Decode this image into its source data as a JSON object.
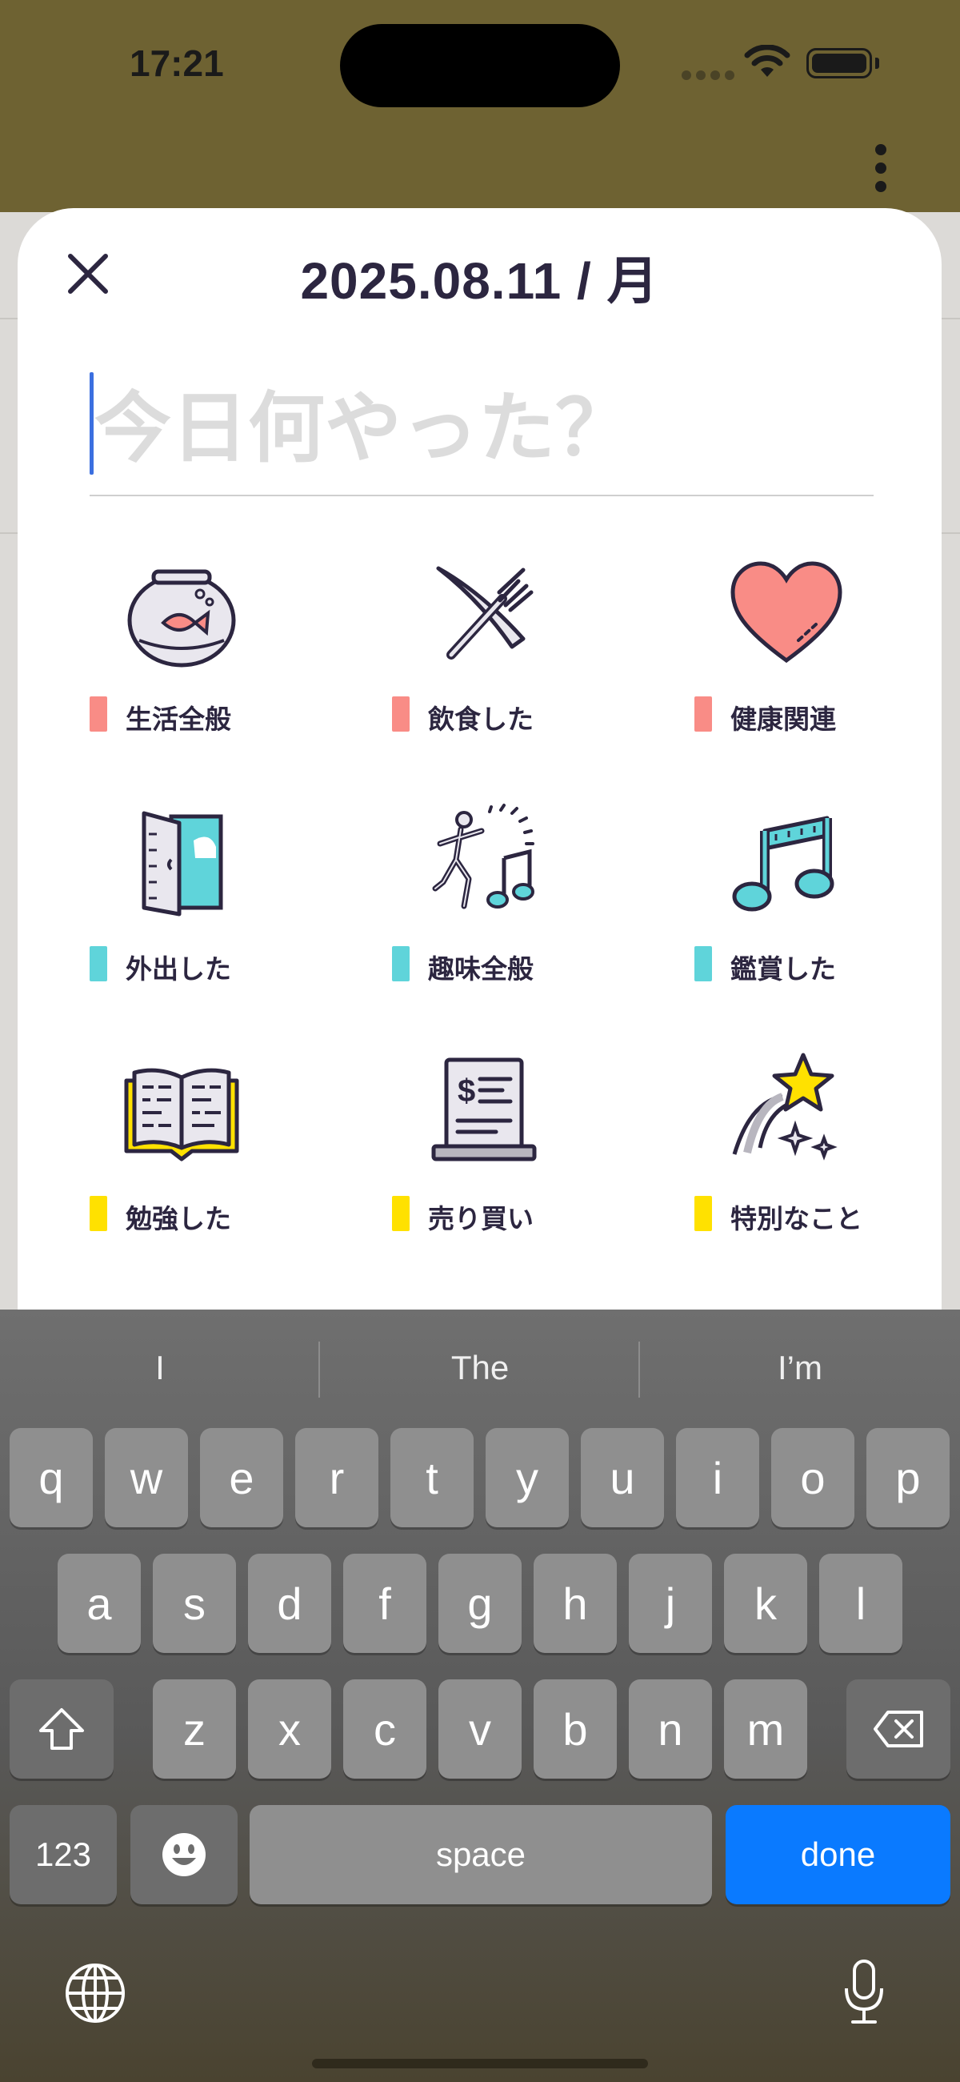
{
  "status": {
    "time": "17:21"
  },
  "sheet": {
    "date_title": "2025.08.11 / 月",
    "input_placeholder": "今日何やった？",
    "categories": [
      {
        "label": "生活全般",
        "icon": "fishbowl-icon",
        "color": "#f98c86"
      },
      {
        "label": "飲食した",
        "icon": "knife-fork-icon",
        "color": "#f98c86"
      },
      {
        "label": "健康関連",
        "icon": "heart-icon",
        "color": "#f98c86"
      },
      {
        "label": "外出した",
        "icon": "door-icon",
        "color": "#5fd4da"
      },
      {
        "label": "趣味全般",
        "icon": "dancer-icon",
        "color": "#5fd4da"
      },
      {
        "label": "鑑賞した",
        "icon": "music-note-icon",
        "color": "#5fd4da"
      },
      {
        "label": "勉強した",
        "icon": "book-icon",
        "color": "#ffe100"
      },
      {
        "label": "売り買い",
        "icon": "receipt-icon",
        "color": "#ffe100"
      },
      {
        "label": "特別なこと",
        "icon": "shooting-star-icon",
        "color": "#ffe100"
      }
    ]
  },
  "keyboard": {
    "suggestions": [
      "I",
      "The",
      "I’m"
    ],
    "row1": [
      "q",
      "w",
      "e",
      "r",
      "t",
      "y",
      "u",
      "i",
      "o",
      "p"
    ],
    "row2": [
      "a",
      "s",
      "d",
      "f",
      "g",
      "h",
      "j",
      "k",
      "l"
    ],
    "row3": [
      "z",
      "x",
      "c",
      "v",
      "b",
      "n",
      "m"
    ],
    "numbers_label": "123",
    "space_label": "space",
    "done_label": "done"
  }
}
